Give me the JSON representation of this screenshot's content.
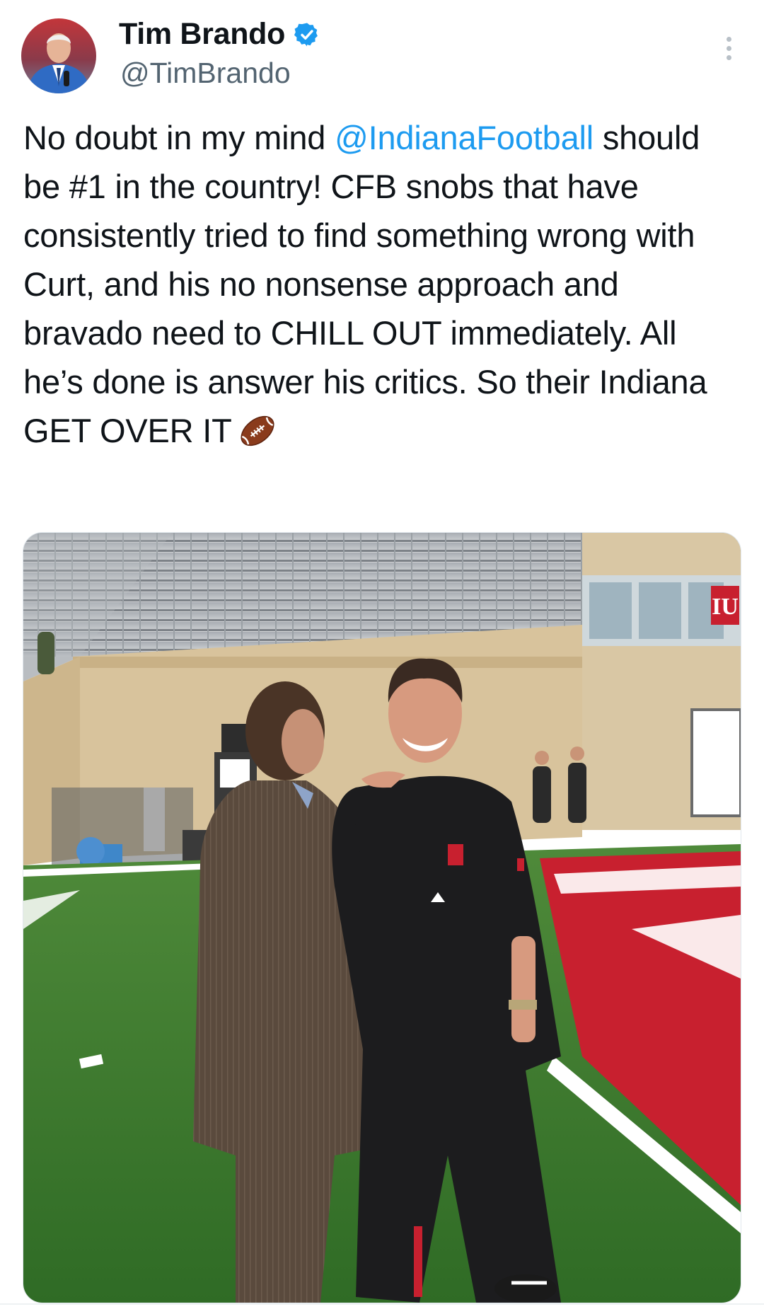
{
  "author": {
    "display_name": "Tim Brando",
    "handle": "@TimBrando",
    "verified": true,
    "avatar_icon": "profile-photo"
  },
  "tweet": {
    "mention": "@IndianaFootball",
    "text_before_mention": "No doubt in my mind ",
    "text_after_mention": " should be #1 in the country! CFB snobs that have consistently tried to find something wrong with Curt, and his no nonsense approach and bravado need to CHILL OUT immediately. All he’s done is answer his critics. So their Indiana GET OVER IT",
    "emoji_icon": "american-football-icon"
  },
  "media": {
    "logo_text": "IU"
  },
  "colors": {
    "accent": "#1d9bf0",
    "text": "#0f1419",
    "secondary": "#536471",
    "turf": "#3f7a2f",
    "endzone": "#c8202f"
  }
}
